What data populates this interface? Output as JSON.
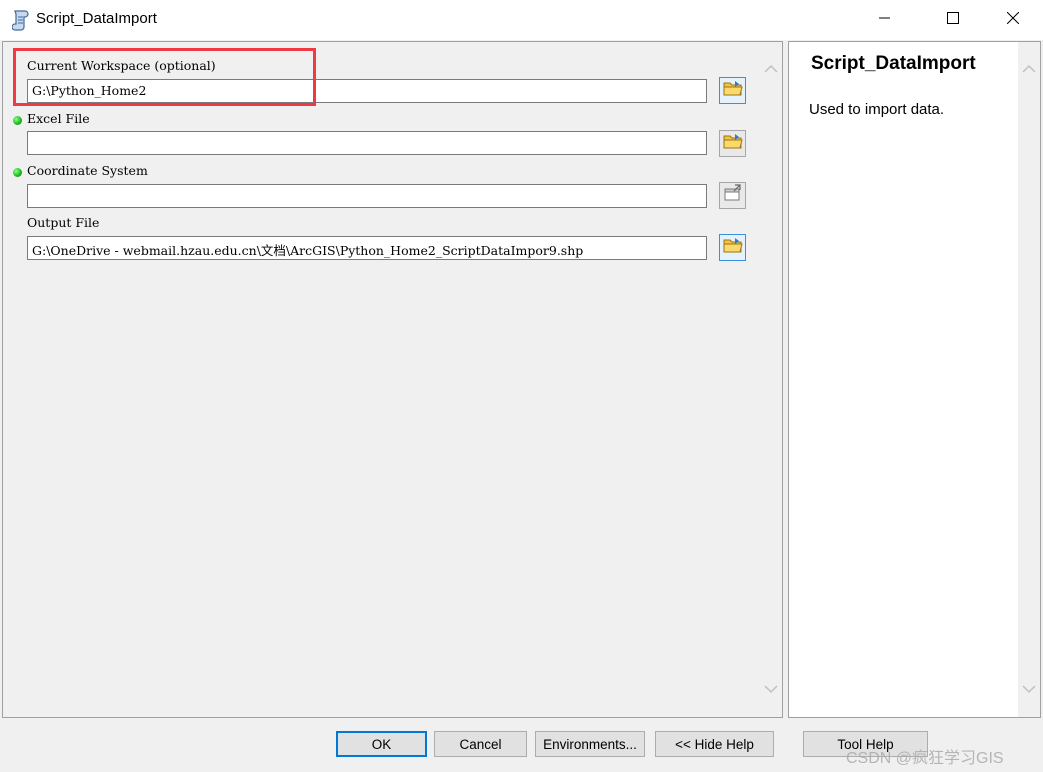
{
  "window": {
    "title": "Script_DataImport",
    "icon": "script-tool-icon",
    "controls": [
      "minimize-icon",
      "maximize-icon",
      "close-icon"
    ]
  },
  "parameters": [
    {
      "label": "Current Workspace (optional)",
      "value": "G:\\Python_Home2",
      "required": false,
      "browse_icon": "open-folder-icon"
    },
    {
      "label": "Excel File",
      "value": "",
      "required": true,
      "browse_icon": "open-folder-icon"
    },
    {
      "label": "Coordinate System",
      "value": "",
      "required": true,
      "browse_icon": "properties-icon"
    },
    {
      "label": "Output File",
      "value": "G:\\OneDrive - webmail.hzau.edu.cn\\文档\\ArcGIS\\Python_Home2_ScriptDataImpor9.shp",
      "required": false,
      "browse_icon": "open-folder-icon"
    }
  ],
  "help": {
    "title": "Script_DataImport",
    "description": "Used to import data."
  },
  "buttons": {
    "ok": "OK",
    "cancel": "Cancel",
    "environments": "Environments...",
    "hide_help": "<< Hide Help",
    "tool_help": "Tool Help"
  },
  "watermark": "CSDN @疯狂学习GIS",
  "colors": {
    "highlight": "#ef3a43",
    "required_dot": "#1cb51c",
    "primary_border": "#0078d7"
  }
}
